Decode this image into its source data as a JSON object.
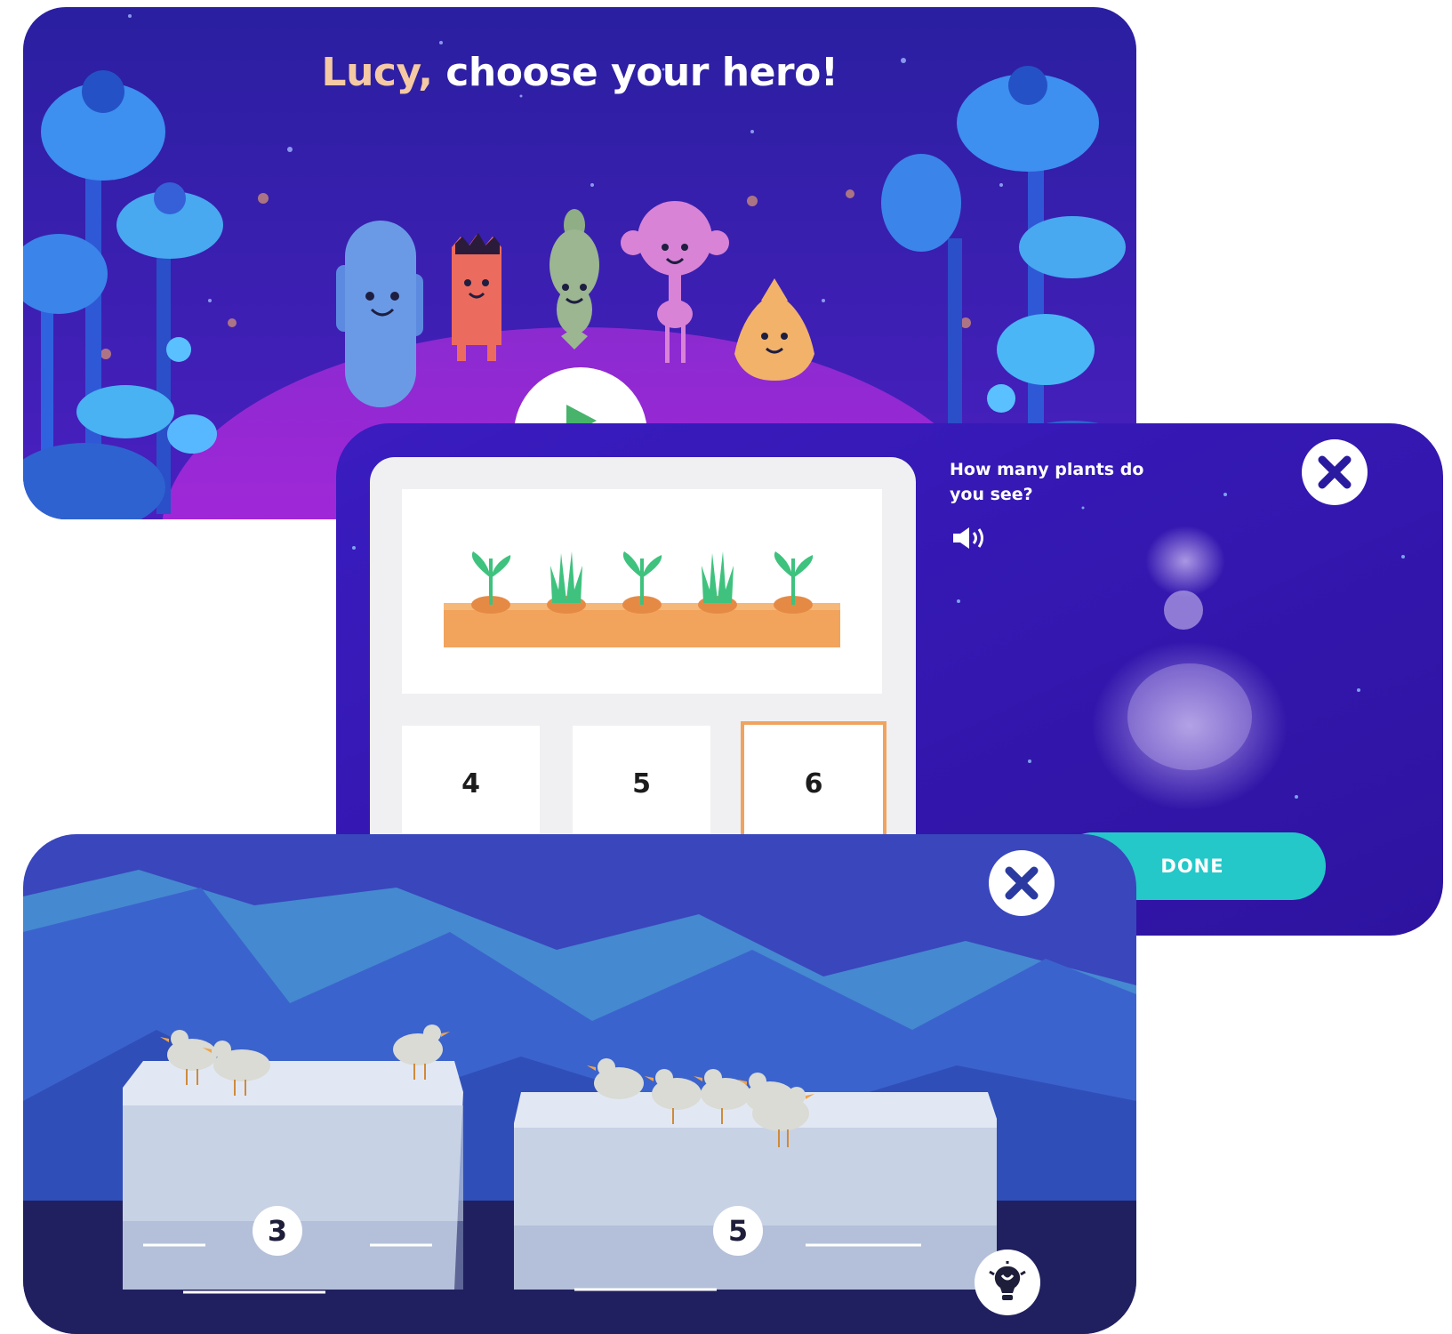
{
  "hero_screen": {
    "title_name": "Lucy,",
    "title_rest": " choose your hero!",
    "heroes": [
      "blue-cactus-hero",
      "red-block-hero",
      "green-sprout-hero",
      "pink-balloon-hero",
      "orange-pinecone-hero"
    ],
    "colors": {
      "sky": "#3a1fb0",
      "hill": "#a326d6",
      "flower": "#3c8ee8"
    }
  },
  "quiz_screen": {
    "question": "How many plants do you see?",
    "choices": [
      "4",
      "5",
      "6"
    ],
    "selected_choice": "6",
    "done_label": "DONE",
    "colors": {
      "sky": "#3b1ab7",
      "accent": "#24c8c9",
      "planter": "#f2a45d",
      "sprout": "#3ec27e",
      "selection": "#f0a35e"
    }
  },
  "iceberg_screen": {
    "left_count": "3",
    "right_count": "5",
    "colors": {
      "sky": "#3a46bc",
      "mountain": "#3a6bd0",
      "water": "#202060",
      "ice": "#dfe6f2"
    }
  },
  "icons": [
    "close-icon",
    "speaker-icon",
    "play-icon",
    "lightbulb-icon"
  ]
}
